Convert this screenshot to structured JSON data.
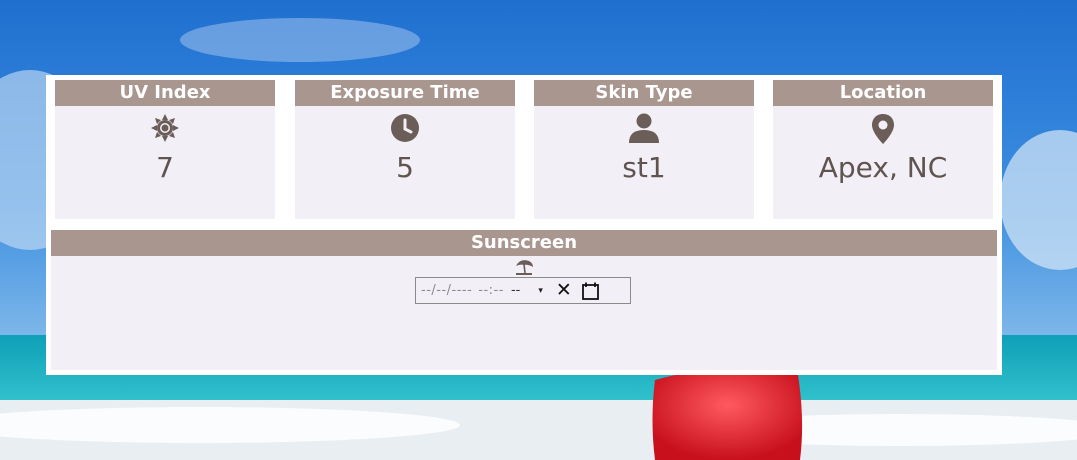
{
  "cards": [
    {
      "label": "UV Index",
      "icon": "sun-icon",
      "value": "7"
    },
    {
      "label": "Exposure Time",
      "icon": "clock-icon",
      "value": "5"
    },
    {
      "label": "Skin Type",
      "icon": "user-icon",
      "value": "st1"
    },
    {
      "label": "Location",
      "icon": "map-marker-icon",
      "value": "Apex, NC"
    }
  ],
  "sunscreen": {
    "label": "Sunscreen",
    "icon": "beach-umbrella-icon",
    "datetime_input": {
      "date_placeholder": "--/--/----",
      "time_placeholder": "--:--",
      "meridiem_placeholder": "--",
      "dropdown_glyph": "▾",
      "clear_glyph": "✕",
      "calendar_icon": "calendar-icon"
    }
  },
  "colors": {
    "header_bg": "#a8968f",
    "card_bg": "#f2f0f6",
    "icon_text": "#6b5e59",
    "value_text": "#5f5450"
  }
}
